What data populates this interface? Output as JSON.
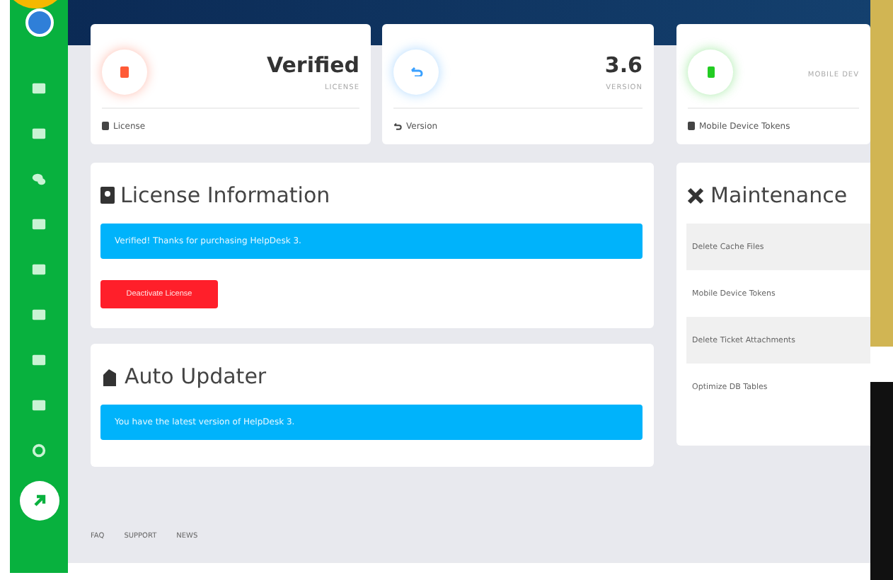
{
  "stat_cards": [
    {
      "kind": "license",
      "value": "Verified",
      "label": "LICENSE",
      "footer": "License"
    },
    {
      "kind": "version",
      "value": "3.6",
      "label": "VERSION",
      "footer": "Version"
    },
    {
      "kind": "mobile",
      "label": "MOBILE DEV",
      "footer": "Mobile Device Tokens"
    }
  ],
  "license_panel": {
    "title": "License Information",
    "alert": "Verified! Thanks for purchasing HelpDesk 3.",
    "button": "Deactivate License"
  },
  "updater_panel": {
    "title": "Auto Updater",
    "alert": "You have the latest version of HelpDesk 3."
  },
  "maintenance": {
    "title": "Maintenance",
    "items": [
      "Delete Cache Files",
      "Mobile Device Tokens",
      "Delete Ticket Attachments",
      "Optimize DB Tables"
    ]
  },
  "footer_links": [
    "FAQ",
    "SUPPORT",
    "NEWS"
  ]
}
